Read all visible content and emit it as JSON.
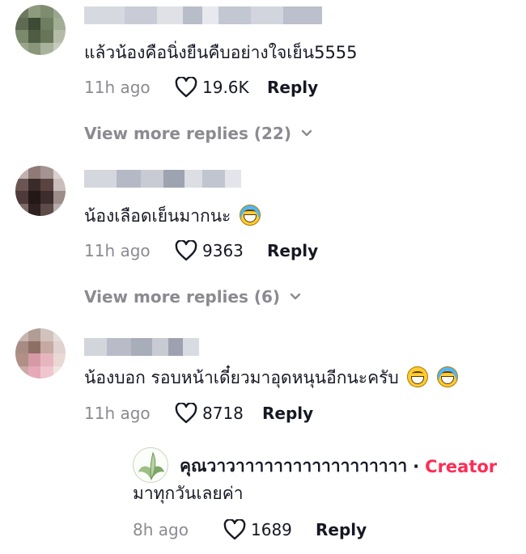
{
  "colors": {
    "text": "#161823",
    "muted": "#8a8b91",
    "creator_tag": "#fe2c55"
  },
  "icons": {
    "like": "heart-outline-icon",
    "expand": "chevron-down-icon"
  },
  "comments": [
    {
      "text": "แล้วน้องคือนิ่งยืนคืบอย่างใจเย็น5555",
      "time": "11h ago",
      "likes": "19.6K",
      "reply_label": "Reply",
      "view_more": "View more replies (22)"
    },
    {
      "text": "น้องเลือดเย็นมากนะ",
      "emoji": [
        "face-with-tears-of-joy-emoji"
      ],
      "time": "11h ago",
      "likes": "9363",
      "reply_label": "Reply",
      "view_more": "View more replies (6)"
    },
    {
      "text": "น้องบอก รอบหน้าเดี๋ยวมาอุดหนุนอีกนะครับ",
      "emoji": [
        "grinning-face-emoji",
        "face-with-tears-of-joy-emoji"
      ],
      "time": "11h ago",
      "likes": "8718",
      "reply_label": "Reply"
    }
  ],
  "creator_reply": {
    "username": "คุณวาวาาาาาาาาาาาาาาาาาา",
    "separator": "·",
    "tag": "Creator",
    "text": "มาทุกวันเลยค่า",
    "time": "8h ago",
    "likes": "1689",
    "reply_label": "Reply"
  }
}
